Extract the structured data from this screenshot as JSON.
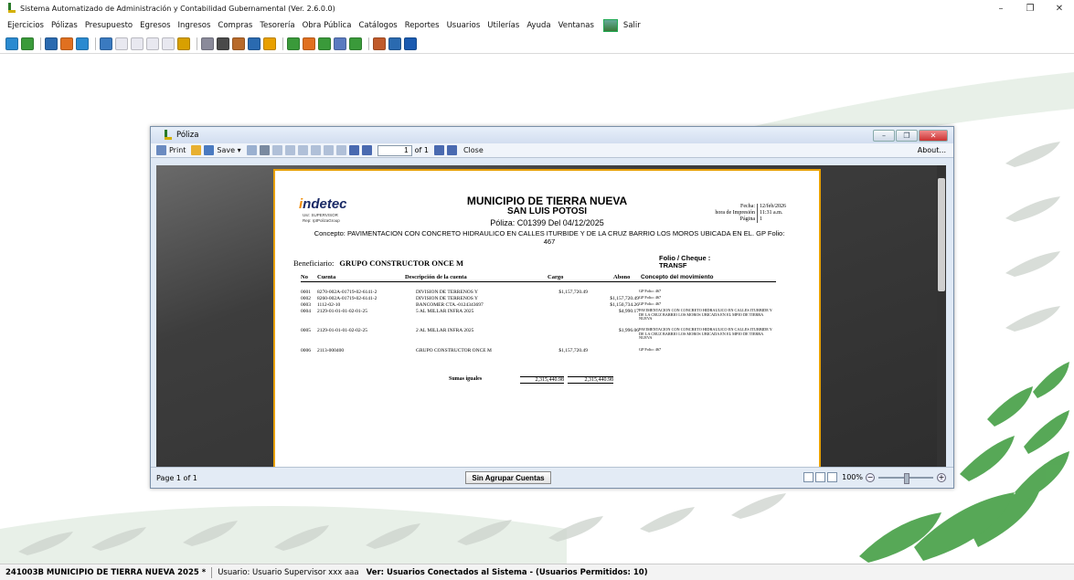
{
  "window": {
    "title": "Sistema Automatizado de Administración y Contabilidad Gubernamental  (Ver. 2.6.0.0)",
    "controls": [
      "–",
      "❐",
      "✕"
    ]
  },
  "menu": [
    "Ejercicios",
    "Pólizas",
    "Presupuesto",
    "Egresos",
    "Ingresos",
    "Compras",
    "Tesorería",
    "Obra Pública",
    "Catálogos",
    "Reportes",
    "Usuarios",
    "Utilerías",
    "Ayuda",
    "Ventanas",
    "Salir"
  ],
  "toolbar_colors": [
    "#2a8ad0",
    "#3a9a3a",
    "#2a6ab0",
    "#e07020",
    "#2a8ad0",
    "#3a7ac0",
    "#e8e8f0",
    "#e8e8f0",
    "#e8e8f0",
    "#e8e8f0",
    "#d8a000",
    "#8a8a9a",
    "#4a4a4a",
    "#b86a2a",
    "#2a6ab0",
    "#e8a000",
    "#3a9a3a",
    "#e07020",
    "#3a9a3a",
    "#5a7ac0",
    "#3a9a3a",
    "#c05a2a",
    "#2a6ab0",
    "#1a5ab0"
  ],
  "child": {
    "title": "Póliza",
    "toolbar": {
      "print": "Print",
      "save": "Save",
      "page_value": "1",
      "page_of": "of 1",
      "close": "Close",
      "about": "About..."
    },
    "status": {
      "page": "Page 1 of 1",
      "button": "Sin Agrupar Cuentas",
      "zoom": "100%"
    }
  },
  "report": {
    "logo": "ndetec",
    "logo_i": "i",
    "user_line": "Usr: SUPERVISOR",
    "rep_line": "Rep: rptPolizaGroup",
    "title1": "MUNICIPIO DE TIERRA NUEVA",
    "title2": "SAN LUIS POTOSI",
    "poliza": "Póliza:  C01399  Del 04/12/2025",
    "concepto": "Concepto: PAVIMENTACION CON CONCRETO HIDRAULICO EN CALLES ITURBIDE Y DE LA CRUZ BARRIO LOS MOROS UBICADA EN EL. GP Folio: 467",
    "fecha_label": "Fecha:",
    "fecha": "12/feb/2026",
    "hora_label": "hora de Impresión",
    "hora": "11:31 a.m.",
    "pagina_label": "Página",
    "pagina": "1",
    "beneficiario_label": "Beneficiario:",
    "beneficiario": "GRUPO CONSTRUCTOR ONCE M",
    "folio_label": "Folio / Cheque :",
    "folio": "TRANSF",
    "columns": {
      "no": "No",
      "cuenta": "Cuenta",
      "descripcion": "Descripción de la cuenta",
      "cargo": "Cargo",
      "abono": "Abono",
      "concepto": "Concepto del movimiento"
    },
    "rows": [
      {
        "no": "0001",
        "cuenta": "8270-002A-01719-02-6141-2",
        "desc": "DIVISION DE TERRENOS Y",
        "cargo": "$1,157,720.49",
        "abono": "",
        "concepto": "GP Folio: 467"
      },
      {
        "no": "0002",
        "cuenta": "8260-002A-01719-02-6141-2",
        "desc": "DIVISION DE TERRENOS Y",
        "cargo": "",
        "abono": "$1,157,720.49",
        "concepto": "GP Folio: 467"
      },
      {
        "no": "0003",
        "cuenta": "1112-02-10",
        "desc": "BANCOMER CTA.-0124343697",
        "cargo": "",
        "abono": "$1,150,734.26",
        "concepto": "GP Folio: 467"
      },
      {
        "no": "0004",
        "cuenta": "2129-01-01-01-02-01-25",
        "desc": "5 AL MILLAR INFRA 2025",
        "cargo": "",
        "abono": "$4,990.17",
        "concepto": "PAVIMENTACION CON CONCRETO HIDRAULICO EN CALLES ITURBIDE Y DE LA CRUZ BARRIO LOS MOROS UBICADA EN EL MPIO DE TIERRA NUEVA"
      },
      {
        "no": "0005",
        "cuenta": "2129-01-01-01-02-02-25",
        "desc": "2 AL MILLAR INFRA 2025",
        "cargo": "",
        "abono": "$1,996.06",
        "concepto": "PAVIMENTACION CON CONCRETO HIDRAULICO EN CALLES ITURBIDE Y DE LA CRUZ BARRIO LOS MOROS UBICADA EN EL MPIO DE TIERRA NUEVA"
      },
      {
        "no": "0006",
        "cuenta": "2113-000400",
        "desc": "GRUPO CONSTRUCTOR ONCE M",
        "cargo": "$1,157,720.49",
        "abono": "",
        "concepto": "GP Folio: 467"
      }
    ],
    "sumas_label": "Sumas iguales",
    "sumas_cargo": "2,315,440.98",
    "sumas_abono": "2,315,440.98"
  },
  "statusbar": {
    "empresa": "241003B MUNICIPIO DE TIERRA NUEVA  2025  *",
    "usuario": "Usuario: Usuario Supervisor xxx aaa",
    "conectados": "Ver: Usuarios Conectados al Sistema - (Usuarios Permitidos: 10)"
  }
}
